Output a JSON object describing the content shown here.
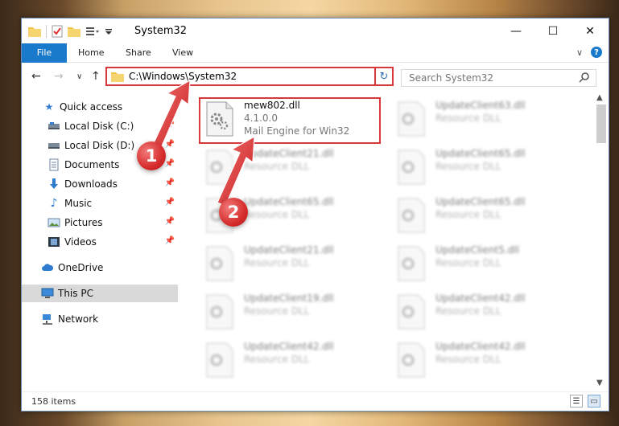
{
  "window": {
    "title": "System32",
    "controls": {
      "minimize": "—",
      "maximize": "☐",
      "close": "✕"
    }
  },
  "ribbon": {
    "tabs": [
      "File",
      "Home",
      "Share",
      "View"
    ],
    "expand": "∨",
    "help": "?"
  },
  "navigation": {
    "back": "←",
    "forward": "→",
    "recent": "∨",
    "up": "↑",
    "address": "C:\\Windows\\System32",
    "address_dropdown": "∨",
    "refresh": "↻",
    "search_placeholder": "Search System32"
  },
  "sidebar": {
    "items": [
      {
        "label": "Quick access",
        "icon": "star-icon"
      },
      {
        "label": "Local Disk (C:)",
        "icon": "drive-icon"
      },
      {
        "label": "Local Disk (D:)",
        "icon": "drive-icon"
      },
      {
        "label": "Documents",
        "icon": "documents-icon"
      },
      {
        "label": "Downloads",
        "icon": "download-icon"
      },
      {
        "label": "Music",
        "icon": "music-icon"
      },
      {
        "label": "Pictures",
        "icon": "pictures-icon"
      },
      {
        "label": "Videos",
        "icon": "videos-icon"
      },
      {
        "label": "OneDrive",
        "icon": "cloud-icon"
      },
      {
        "label": "This PC",
        "icon": "pc-icon",
        "selected": true
      },
      {
        "label": "Network",
        "icon": "network-icon"
      }
    ]
  },
  "files": {
    "highlighted": {
      "name": "mew802.dll",
      "version": "4.1.0.0",
      "description": "Mail Engine for Win32"
    },
    "left_column": [
      {
        "name": "UpdateClient21.dll",
        "sub": "Resource DLL"
      },
      {
        "name": "UpdateClient65.dll",
        "sub": "Resource DLL"
      },
      {
        "name": "UpdateClient21.dll",
        "sub": "Resource DLL"
      },
      {
        "name": "UpdateClient19.dll",
        "sub": "Resource DLL"
      },
      {
        "name": "UpdateClient42.dll",
        "sub": "Resource DLL"
      }
    ],
    "right_column": [
      {
        "name": "UpdateClient63.dll",
        "sub": "Resource DLL"
      },
      {
        "name": "UpdateClient65.dll",
        "sub": "Resource DLL"
      },
      {
        "name": "UpdateClient65.dll",
        "sub": "Resource DLL"
      },
      {
        "name": "UpdateClient5.dll",
        "sub": "Resource DLL"
      },
      {
        "name": "UpdateClient42.dll",
        "sub": "Resource DLL"
      },
      {
        "name": "UpdateClient42.dll",
        "sub": "Resource DLL"
      }
    ]
  },
  "status": {
    "item_count": "158 items"
  },
  "annotations": {
    "step1": "1",
    "step2": "2"
  },
  "colors": {
    "accent": "#1979ca",
    "highlight": "#d9373a",
    "badge": "#d62c2c"
  }
}
